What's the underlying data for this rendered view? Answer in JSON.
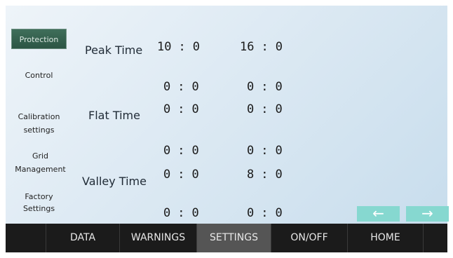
{
  "sidebar": {
    "active_item": "Protection",
    "items": [
      {
        "label": "Control"
      },
      {
        "label_line1": "Calibration",
        "label_line2": "settings"
      },
      {
        "label_line1": "Grid",
        "label_line2": "Management"
      },
      {
        "label_line1": "Factory",
        "label_line2": "Settings"
      }
    ]
  },
  "rows": {
    "peak_label": "Peak Time",
    "flat_label": "Flat Time",
    "valley_label": "Valley Time",
    "r1": {
      "a_h": "10",
      "a_m": "0",
      "b_h": "16",
      "b_m": "0"
    },
    "r2": {
      "a_h": "0",
      "a_m": "0",
      "b_h": "0",
      "b_m": "0"
    },
    "r3": {
      "a_h": "0",
      "a_m": "0",
      "b_h": "0",
      "b_m": "0"
    },
    "r4": {
      "a_h": "0",
      "a_m": "0",
      "b_h": "0",
      "b_m": "0"
    },
    "r5": {
      "a_h": "0",
      "a_m": "0",
      "b_h": "8",
      "b_m": "0"
    },
    "r6": {
      "a_h": "0",
      "a_m": "0",
      "b_h": "0",
      "b_m": "0"
    },
    "separator": ":"
  },
  "nav_arrows": {
    "prev": "←",
    "next": "→"
  },
  "tabs": [
    "DATA",
    "WARNINGS",
    "SETTINGS",
    "ON/OFF",
    "HOME"
  ],
  "active_tab": "SETTINGS",
  "colors": {
    "active_side": "#2f5a48",
    "arrow_bg": "#86d8d0",
    "bar_bg": "#1b1b1b",
    "active_tab_bg": "#555555"
  }
}
